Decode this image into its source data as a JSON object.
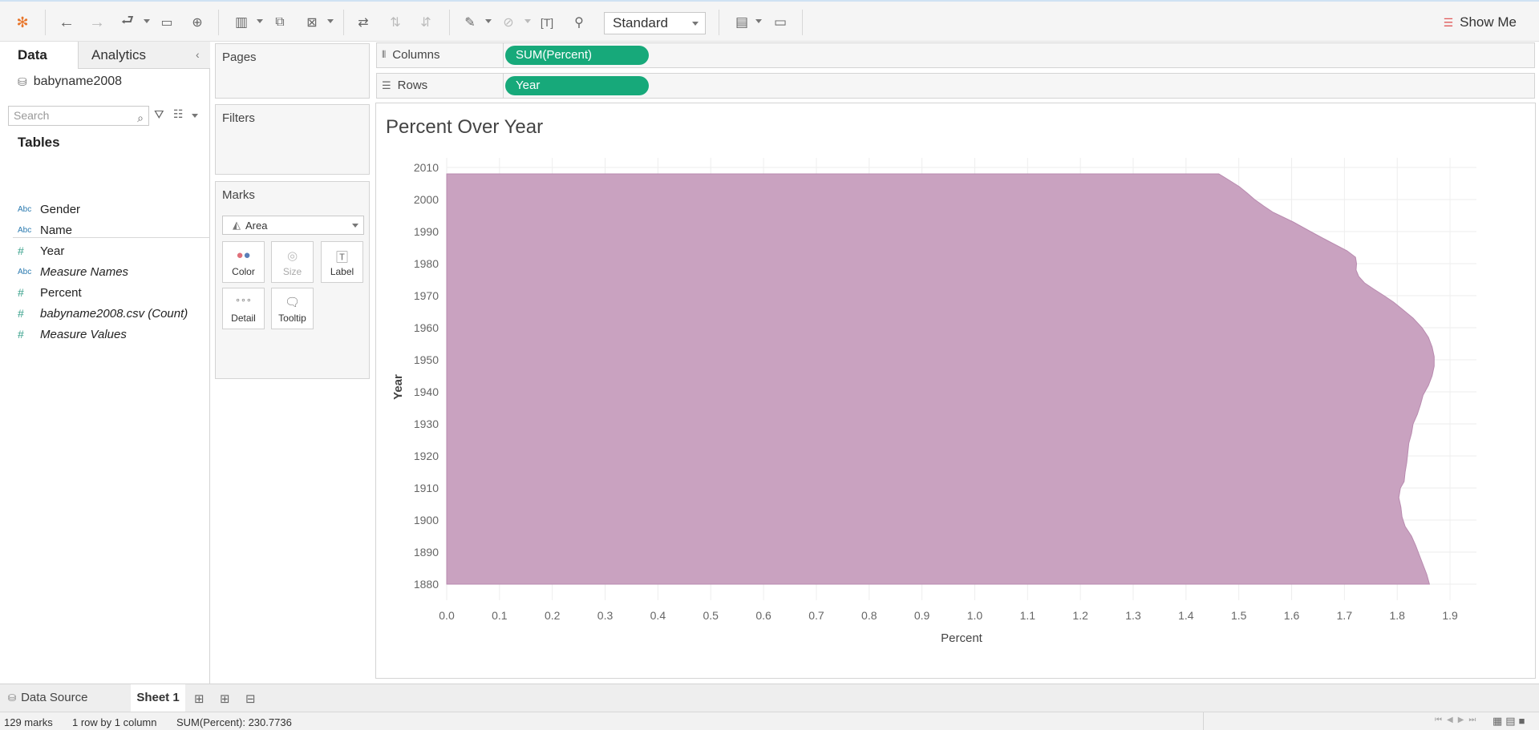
{
  "toolbar": {
    "fit_mode": "Standard",
    "show_me_label": "Show Me",
    "icons": [
      "tableau-logo-icon",
      "undo-icon",
      "redo-icon",
      "redo-to-icon",
      "save-icon",
      "new-datasource-icon",
      "new-worksheet-icon",
      "duplicate-icon",
      "clear-sheet-icon",
      "swap-icon",
      "sort-ascending-icon",
      "sort-descending-icon",
      "highlight-icon",
      "group-icon",
      "label-icon",
      "pin-icon",
      "show-cards-icon",
      "presentation-icon"
    ]
  },
  "data_pane": {
    "tab_data": "Data",
    "tab_analytics": "Analytics",
    "datasource_name": "babyname2008",
    "search_placeholder": "Search",
    "tables_header": "Tables",
    "fields": [
      {
        "type_label": "Abc",
        "name": "Gender",
        "italic": false,
        "kind": "dim"
      },
      {
        "type_label": "Abc",
        "name": "Name",
        "italic": false,
        "kind": "dim"
      },
      {
        "type_label": "#",
        "name": "Year",
        "italic": false,
        "kind": "num"
      },
      {
        "type_label": "Abc",
        "name": "Measure Names",
        "italic": true,
        "kind": "dim"
      },
      {
        "type_label": "#",
        "name": "Percent",
        "italic": false,
        "kind": "num"
      },
      {
        "type_label": "#",
        "name": "babyname2008.csv (Count)",
        "italic": true,
        "kind": "num"
      },
      {
        "type_label": "#",
        "name": "Measure Values",
        "italic": true,
        "kind": "num"
      }
    ]
  },
  "cards": {
    "pages": "Pages",
    "filters": "Filters",
    "marks": "Marks",
    "mark_type": "Area",
    "mark_buttons": [
      "Color",
      "Size",
      "Label",
      "Detail",
      "Tooltip"
    ]
  },
  "shelves": {
    "columns_label": "Columns",
    "columns_pill": "SUM(Percent)",
    "rows_label": "Rows",
    "rows_pill": "Year"
  },
  "viz": {
    "title": "Percent Over Year"
  },
  "chart_data": {
    "type": "area",
    "title": "Percent Over Year",
    "orientation": "horizontal",
    "xlabel": "Percent",
    "ylabel": "Year",
    "xlim": [
      0,
      1.95
    ],
    "ylim": [
      1875,
      2013
    ],
    "x_ticks": [
      "0.0",
      "0.1",
      "0.2",
      "0.3",
      "0.4",
      "0.5",
      "0.6",
      "0.7",
      "0.8",
      "0.9",
      "1.0",
      "1.1",
      "1.2",
      "1.3",
      "1.4",
      "1.5",
      "1.6",
      "1.7",
      "1.8",
      "1.9"
    ],
    "y_ticks": [
      "1880",
      "1890",
      "1900",
      "1910",
      "1920",
      "1930",
      "1940",
      "1950",
      "1960",
      "1970",
      "1980",
      "1990",
      "2000",
      "2010"
    ],
    "color": "#c9a2c0",
    "grid": true,
    "series": [
      {
        "points": [
          [
            1880,
            1.861
          ],
          [
            1883,
            1.856
          ],
          [
            1886,
            1.849
          ],
          [
            1889,
            1.842
          ],
          [
            1892,
            1.835
          ],
          [
            1895,
            1.827
          ],
          [
            1898,
            1.815
          ],
          [
            1901,
            1.809
          ],
          [
            1904,
            1.807
          ],
          [
            1907,
            1.803
          ],
          [
            1910,
            1.806
          ],
          [
            1912,
            1.813
          ],
          [
            1915,
            1.815
          ],
          [
            1918,
            1.818
          ],
          [
            1921,
            1.82
          ],
          [
            1924,
            1.822
          ],
          [
            1927,
            1.827
          ],
          [
            1930,
            1.83
          ],
          [
            1933,
            1.838
          ],
          [
            1936,
            1.844
          ],
          [
            1939,
            1.849
          ],
          [
            1942,
            1.859
          ],
          [
            1945,
            1.866
          ],
          [
            1948,
            1.87
          ],
          [
            1951,
            1.87
          ],
          [
            1954,
            1.866
          ],
          [
            1957,
            1.859
          ],
          [
            1960,
            1.847
          ],
          [
            1963,
            1.83
          ],
          [
            1966,
            1.808
          ],
          [
            1968,
            1.793
          ],
          [
            1970,
            1.775
          ],
          [
            1972,
            1.756
          ],
          [
            1974,
            1.738
          ],
          [
            1976,
            1.727
          ],
          [
            1978,
            1.722
          ],
          [
            1980,
            1.723
          ],
          [
            1982,
            1.721
          ],
          [
            1984,
            1.705
          ],
          [
            1987,
            1.67
          ],
          [
            1990,
            1.636
          ],
          [
            1993,
            1.603
          ],
          [
            1996,
            1.565
          ],
          [
            1998,
            1.547
          ],
          [
            2000,
            1.53
          ],
          [
            2002,
            1.516
          ],
          [
            2004,
            1.501
          ],
          [
            2006,
            1.482
          ],
          [
            2008,
            1.462
          ]
        ]
      }
    ]
  },
  "bottom_tabs": {
    "data_source": "Data Source",
    "sheet1": "Sheet 1"
  },
  "status": {
    "marks": "129 marks",
    "dims": "1 row by 1 column",
    "sum": "SUM(Percent): 230.7736"
  }
}
